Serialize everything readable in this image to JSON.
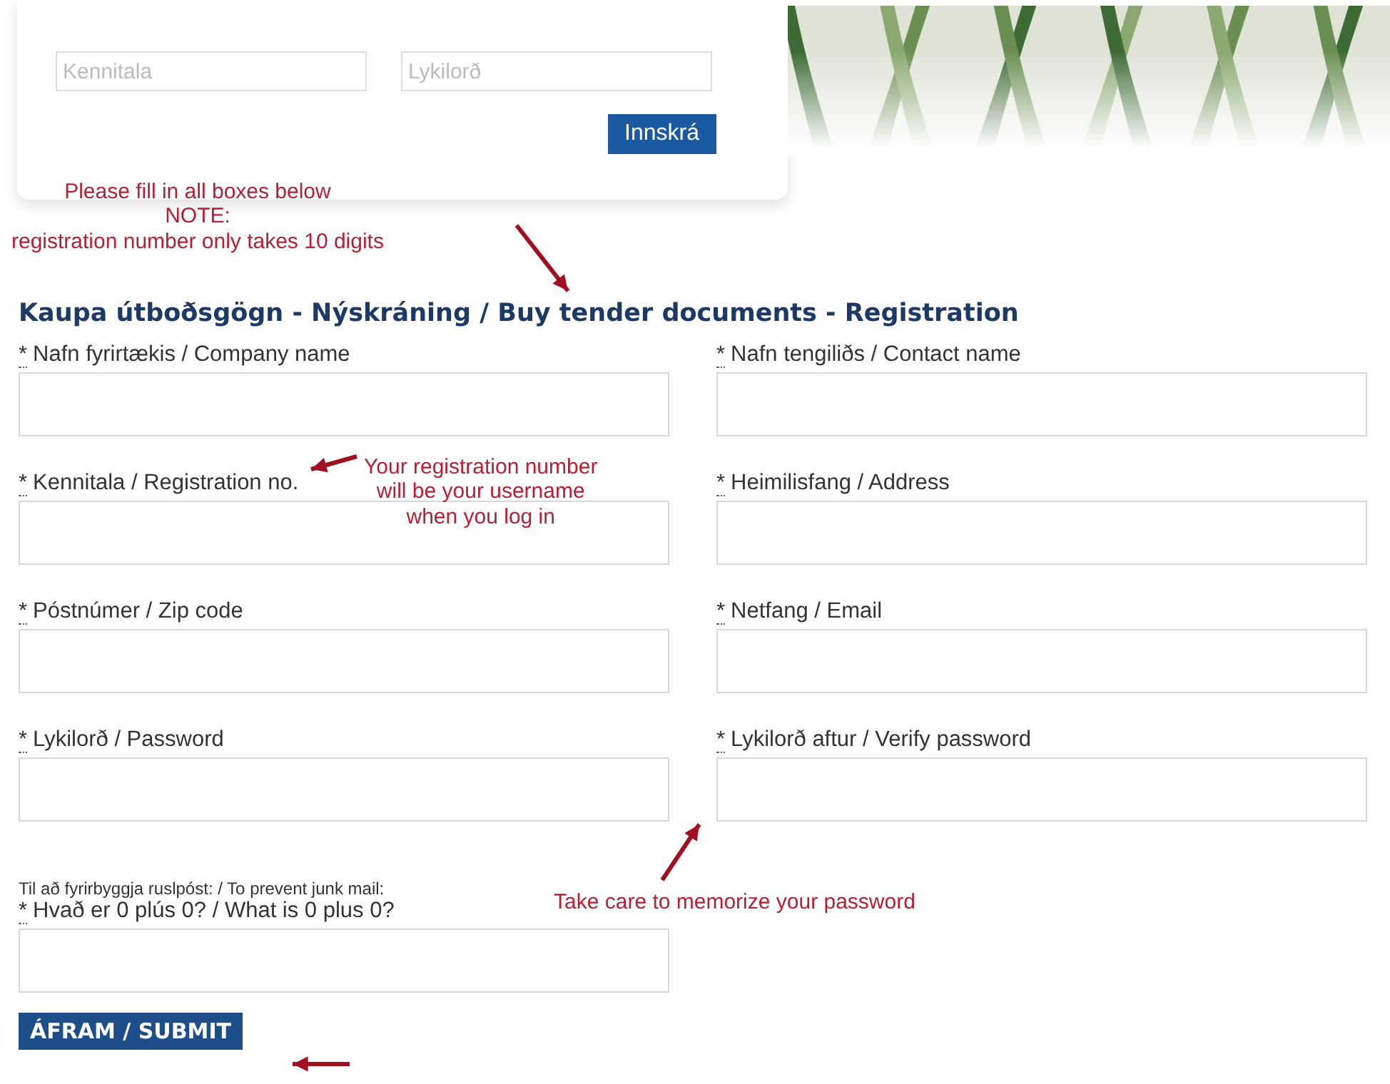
{
  "login": {
    "fields": [
      {
        "placeholder": "Kennitala"
      },
      {
        "placeholder": "Lykilorð"
      }
    ],
    "button": "Innskrá"
  },
  "form": {
    "title": "Kaupa útboðsgögn - Nýskráning / Buy tender documents - Registration",
    "fields": [
      {
        "marker": "*",
        "label": "Nafn fyrirtækis / Company name"
      },
      {
        "marker": "*",
        "label": "Nafn tengiliðs / Contact name"
      },
      {
        "marker": "*",
        "label": "Kennitala / Registration no."
      },
      {
        "marker": "*",
        "label": "Heimilisfang / Address"
      },
      {
        "marker": "*",
        "label": "Póstnúmer / Zip code"
      },
      {
        "marker": "*",
        "label": "Netfang / Email"
      },
      {
        "marker": "*",
        "label": "Lykilorð / Password"
      },
      {
        "marker": "*",
        "label": "Lykilorð aftur / Verify password"
      }
    ],
    "spam_note": "Til að fyrirbyggja ruslpóst: / To prevent junk mail:",
    "captcha": {
      "marker": "*",
      "label": "Hvað er 0 plús 0? / What is 0 plus 0?"
    },
    "submit": "ÁFRAM / SUBMIT"
  },
  "annotations": [
    {
      "lines": [
        "Please fill in all boxes below",
        "NOTE:",
        "registration number only takes 10 digits"
      ]
    },
    {
      "lines": [
        "Your registration number",
        "will be your username",
        "when you log in"
      ]
    },
    {
      "lines": [
        "Take care to memorize your password"
      ]
    }
  ]
}
